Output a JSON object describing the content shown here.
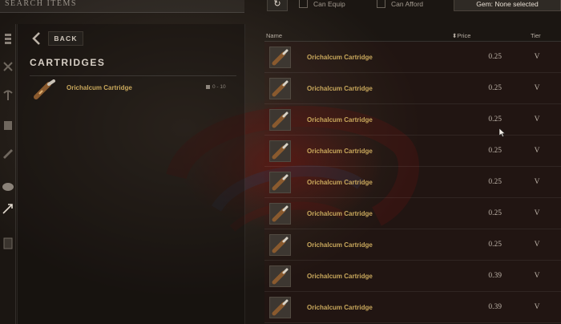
{
  "header": {
    "search_title": "SEARCH ITEMS"
  },
  "filters": {
    "refresh_icon": "refresh-icon",
    "can_equip": {
      "label": "Can Equip",
      "checked": false
    },
    "can_afford": {
      "label": "Can Afford",
      "checked": false
    },
    "gem_label": "Gem: None selected"
  },
  "sidebar": {
    "icons": [
      "menu-icon",
      "crossed-swords-icon",
      "pickaxe-icon",
      "armor-icon",
      "tool-icon",
      "round-shield-icon",
      "arrow-icon",
      "bag-icon"
    ]
  },
  "left_panel": {
    "back_label": "BACK",
    "category_title": "CARTRIDGES",
    "items": [
      {
        "name": "Orichalcum Cartridge",
        "meta": "0 - 10"
      }
    ]
  },
  "table": {
    "columns": {
      "name": "Name",
      "price": "Price",
      "tier": "Tier"
    },
    "rows": [
      {
        "name": "Orichalcum Cartridge",
        "price": "0.25",
        "tier": "V"
      },
      {
        "name": "Orichalcum Cartridge",
        "price": "0.25",
        "tier": "V"
      },
      {
        "name": "Orichalcum Cartridge",
        "price": "0.25",
        "tier": "V"
      },
      {
        "name": "Orichalcum Cartridge",
        "price": "0.25",
        "tier": "V"
      },
      {
        "name": "Orichalcum Cartridge",
        "price": "0.25",
        "tier": "V"
      },
      {
        "name": "Orichalcum Cartridge",
        "price": "0.25",
        "tier": "V"
      },
      {
        "name": "Orichalcum Cartridge",
        "price": "0.25",
        "tier": "V"
      },
      {
        "name": "Orichalcum Cartridge",
        "price": "0.39",
        "tier": "V"
      },
      {
        "name": "Orichalcum Cartridge",
        "price": "0.39",
        "tier": "V"
      }
    ]
  },
  "colors": {
    "item_name": "#c9a85c",
    "accent_red": "#7a1410"
  }
}
